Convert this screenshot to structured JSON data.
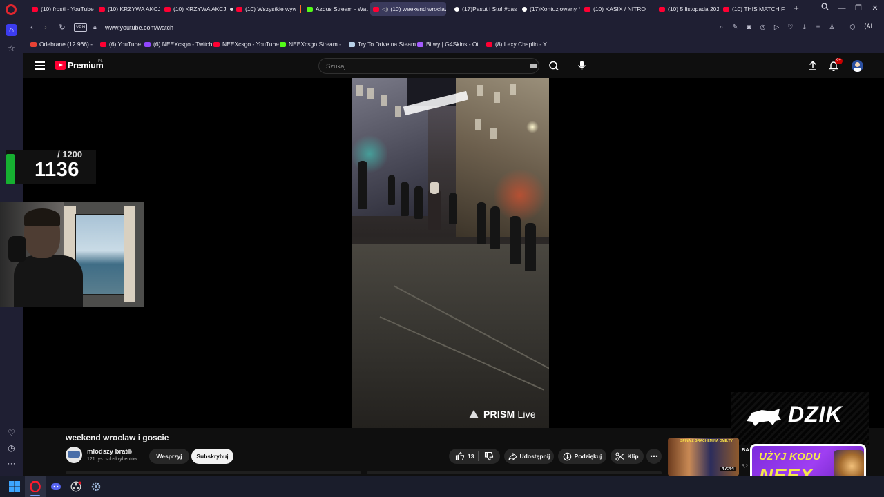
{
  "browser": {
    "tabs": [
      {
        "label": "(10) frosti - YouTube",
        "icon": "youtube-icon"
      },
      {
        "label": "(10) KRZYWA AKCJA",
        "icon": "youtube-icon"
      },
      {
        "label": "(10) KRZYWA AKCJA",
        "icon": "youtube-icon"
      },
      {
        "label": "(10) Wszystkie wywia",
        "icon": "youtube-icon"
      },
      {
        "label": "Azdus Stream - Watc",
        "icon": "kick-icon"
      },
      {
        "label": "(10) weekend wroclaw",
        "icon": "youtube-icon",
        "active": true
      },
      {
        "label": "(17)Pasut i Stu! #pas",
        "icon": "tiktok-icon"
      },
      {
        "label": "(17)Kontuzjowany Ni",
        "icon": "tiktok-icon"
      },
      {
        "label": "(10) KASIX / NITRO H",
        "icon": "youtube-icon"
      },
      {
        "label": "(10) 5 listopada 2025",
        "icon": "youtube-icon"
      },
      {
        "label": "(10) THIS MATCH FE",
        "icon": "youtube-icon"
      }
    ],
    "vpn_label": "VPN",
    "url": "www.youtube.com/watch",
    "ai_label": "AI",
    "bookmarks": [
      {
        "label": "Odebrane (12 966) -...",
        "icon": "gmail-icon"
      },
      {
        "label": "(6) YouTube",
        "icon": "youtube-icon"
      },
      {
        "label": "(6) NEEXcsgo - Twitch",
        "icon": "twitch-icon"
      },
      {
        "label": "NEEXcsgo - YouTube",
        "icon": "youtube-icon"
      },
      {
        "label": "NEEXcsgo Stream -...",
        "icon": "kick-icon"
      },
      {
        "label": "Try To Drive na Steam",
        "icon": "steam-icon"
      },
      {
        "label": "Bitwy | G4Skins - Ot...",
        "icon": "g4skins-icon"
      },
      {
        "label": "(8) Lexy Chaplin - Y...",
        "icon": "youtube-icon"
      }
    ]
  },
  "youtube": {
    "brand": "Premium",
    "region": "PL",
    "search_placeholder": "Szukaj",
    "notifications": "9+",
    "video": {
      "title": "weekend wroclaw i goscie",
      "channel": "młodszy brat",
      "subscribers": "121 tys. subskrybentów",
      "support_label": "Wesprzyj",
      "subscribe_label": "Subskrybuj",
      "likes": "13",
      "share_label": "Udostępnij",
      "thanks_label": "Podziękuj",
      "clip_label": "Klip",
      "watermark": "PRISM",
      "watermark_suffix": "Live"
    },
    "recommended": {
      "thumb_text": "SPINA Z GRACHEM NA OME.TV",
      "duration": "47:44",
      "title": "BA",
      "meta": "5,2"
    }
  },
  "overlays": {
    "counter_total": "/ 1200",
    "counter_value": "1136",
    "sponsor": "DZIK",
    "promo_line1": "UŻYJ KODU",
    "promo_line2": "NEEX"
  },
  "colors": {
    "browser_bg": "#1f1f33",
    "yt_bg": "#0f0f0f",
    "yt_red": "#ff0033",
    "counter_green": "#16b031",
    "promo_purple": "#9f3ff2",
    "promo_yellow": "#f6e94a"
  }
}
